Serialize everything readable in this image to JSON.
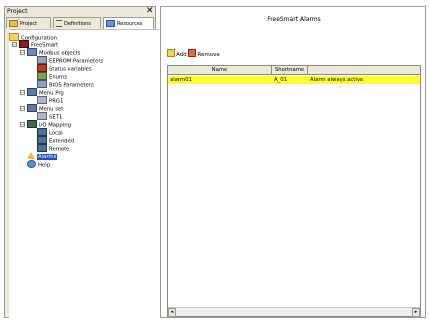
{
  "left_panel": {
    "title": "Project",
    "close_glyph": "✕",
    "tabs": [
      {
        "label": "Project",
        "icon": "project-icon"
      },
      {
        "label": "Definitions",
        "icon": "definitions-icon"
      },
      {
        "label": "Resources",
        "icon": "resources-icon"
      }
    ],
    "tree": {
      "configuration": "Configuration",
      "freesmart": "FreeSmart",
      "modbus_objects": "Modbus objects",
      "eeprom_parameters": "EEPROM Parameters",
      "status_variables": "Status variables",
      "enums": "Enums",
      "bios_parameters": "BIOS Parameters",
      "menu_prg": "Menu Prg",
      "prg1": "PRG1",
      "menu_set": "Menu set",
      "set1": "SET1",
      "io_mapping": "I/O Mapping",
      "local": "Local",
      "extended": "Extended",
      "remote": "Remote",
      "alarms": "Alarms",
      "help": "Help"
    }
  },
  "right_panel": {
    "title": "FreeSmart Alarms",
    "toolbar": {
      "add_label": "Add",
      "remove_label": "Remove"
    },
    "table": {
      "columns": [
        "Name",
        "Shortname",
        ""
      ],
      "rows": [
        {
          "name": "alarm01",
          "shortname": "A_01",
          "description": "Alarm always active"
        }
      ]
    }
  },
  "colors": {
    "selection_blue": "#1c50c8",
    "row_highlight": "#ffff33",
    "panel_bg": "#ece9d8"
  }
}
